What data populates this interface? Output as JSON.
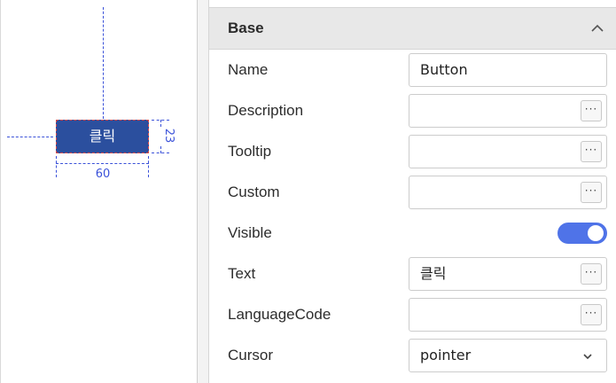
{
  "canvas": {
    "preview_button_label": "클릭",
    "height_dimension": "23",
    "width_dimension": "60"
  },
  "properties": {
    "section_title": "Base",
    "rows": [
      {
        "label": "Name",
        "value": "Button",
        "control": "text"
      },
      {
        "label": "Description",
        "value": "",
        "control": "text-ellipsis"
      },
      {
        "label": "Tooltip",
        "value": "",
        "control": "text-ellipsis"
      },
      {
        "label": "Custom",
        "value": "",
        "control": "text-ellipsis"
      },
      {
        "label": "Visible",
        "value": true,
        "control": "toggle"
      },
      {
        "label": "Text",
        "value": "클릭",
        "control": "text-ellipsis"
      },
      {
        "label": "LanguageCode",
        "value": "",
        "control": "text-ellipsis"
      },
      {
        "label": "Cursor",
        "value": "pointer",
        "control": "select"
      }
    ],
    "ellipsis_label": "···"
  },
  "colors": {
    "accent": "#4f73e8",
    "preview_button_bg": "#2b4f9e",
    "guide_line": "#3b52d9",
    "selection_border": "#d94a4a"
  },
  "icons": {
    "collapse": "chevron-up-icon",
    "select": "chevron-down-icon"
  }
}
